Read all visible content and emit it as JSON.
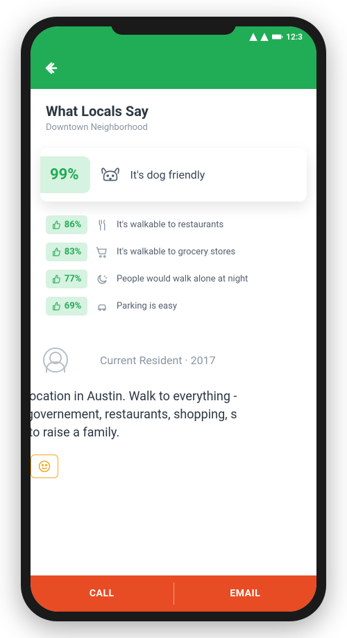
{
  "status_bar": {
    "time": "12:3"
  },
  "header": {
    "title": "What Locals Say",
    "subtitle": "Downtown Neighborhood"
  },
  "highlight": {
    "percent": "99%",
    "label": "It's dog friendly"
  },
  "stats": [
    {
      "percent": "86%",
      "label": "It's walkable to restaurants"
    },
    {
      "percent": "83%",
      "label": "It's walkable to grocery stores"
    },
    {
      "percent": "77%",
      "label": "People would walk alone at night"
    },
    {
      "percent": "69%",
      "label": "Parking is easy"
    }
  ],
  "review": {
    "author_role": "Current Resident",
    "year": "2017",
    "meta": "Current Resident · 2017",
    "body_visible": "st location in Austin. Walk to everything -\nte governement, restaurants, shopping, s\nce to raise a family."
  },
  "actions": {
    "call": "CALL",
    "email": "EMAIL"
  },
  "colors": {
    "brand_green": "#21ac56",
    "mint": "#d6f2e0",
    "action_orange": "#e84c24",
    "accent_yellow": "#f6a623"
  }
}
